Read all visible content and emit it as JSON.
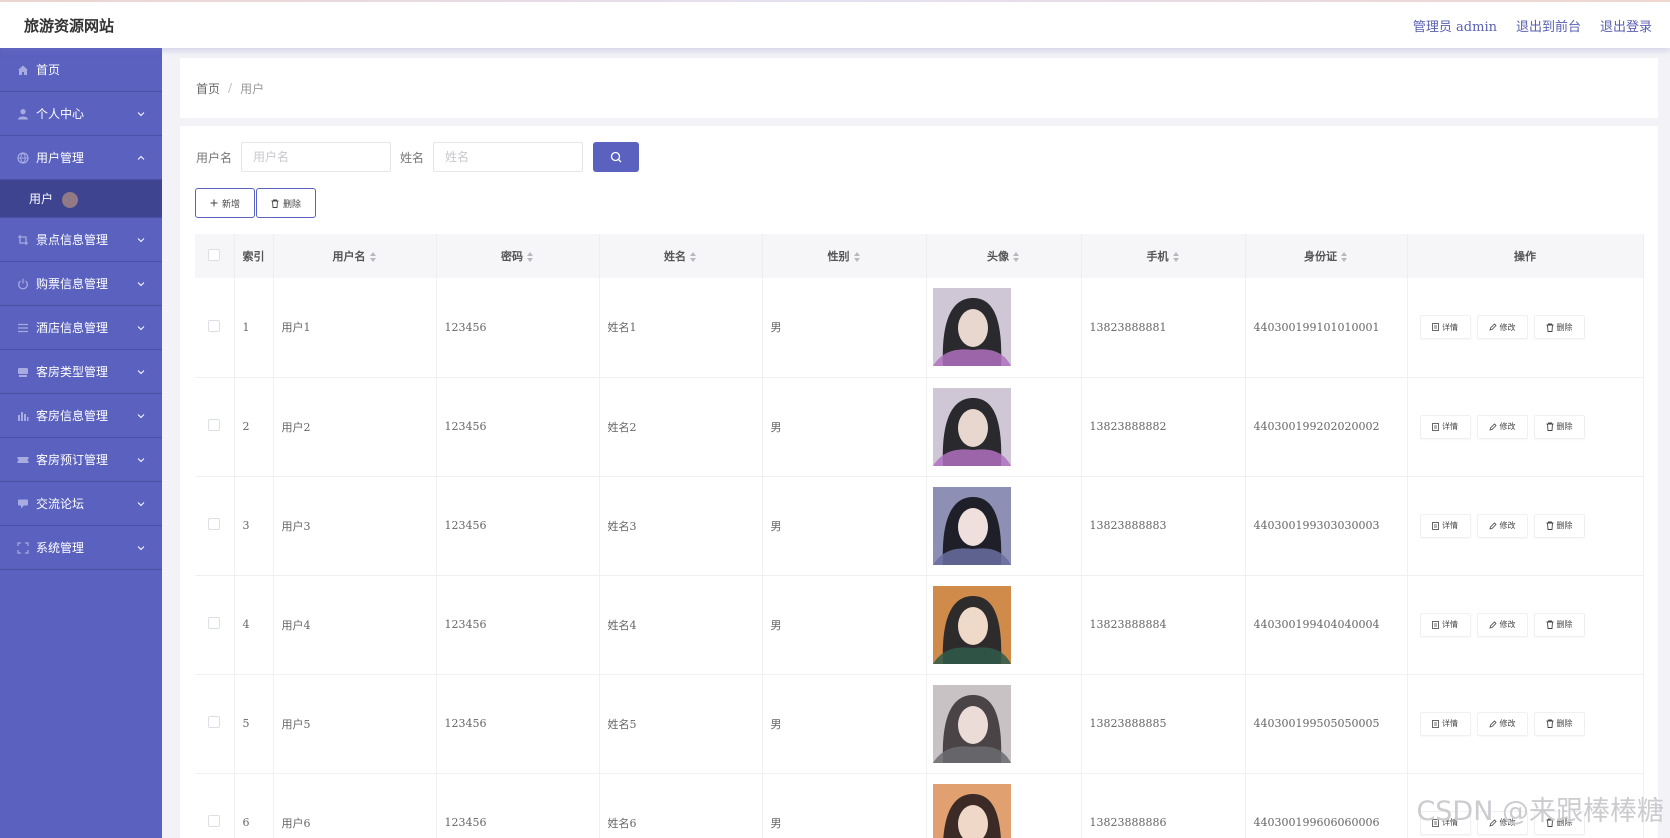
{
  "header": {
    "brand": "旅游资源网站",
    "admin_label": "管理员 admin",
    "front_link": "退出到前台",
    "logout_link": "退出登录"
  },
  "sidebar": {
    "items": [
      {
        "label": "首页",
        "icon": "home-icon",
        "has_children": false
      },
      {
        "label": "个人中心",
        "icon": "user-icon",
        "has_children": true
      },
      {
        "label": "用户管理",
        "icon": "globe-icon",
        "has_children": true,
        "expanded": true
      },
      {
        "label": "景点信息管理",
        "icon": "crop-icon",
        "has_children": true
      },
      {
        "label": "购票信息管理",
        "icon": "power-icon",
        "has_children": true
      },
      {
        "label": "酒店信息管理",
        "icon": "list-icon",
        "has_children": true
      },
      {
        "label": "客房类型管理",
        "icon": "bed-icon",
        "has_children": true
      },
      {
        "label": "客房信息管理",
        "icon": "chart-icon",
        "has_children": true
      },
      {
        "label": "客房预订管理",
        "icon": "ticket-icon",
        "has_children": true
      },
      {
        "label": "交流论坛",
        "icon": "chat-icon",
        "has_children": true
      },
      {
        "label": "系统管理",
        "icon": "fullscreen-icon",
        "has_children": true
      }
    ],
    "submenu": {
      "label": "用户"
    }
  },
  "breadcrumb": {
    "home": "首页",
    "separator": "/",
    "current": "用户"
  },
  "search": {
    "username_label": "用户名",
    "username_placeholder": "用户名",
    "name_label": "姓名",
    "name_placeholder": "姓名"
  },
  "actions": {
    "add_label": "新增",
    "delete_label": "删除"
  },
  "table": {
    "headers": {
      "index": "索引",
      "username": "用户名",
      "password": "密码",
      "name": "姓名",
      "gender": "性别",
      "avatar": "头像",
      "phone": "手机",
      "idcard": "身份证",
      "ops": "操作"
    },
    "op_labels": {
      "detail": "详情",
      "edit": "修改",
      "delete": "删除"
    },
    "rows": [
      {
        "index": "1",
        "username": "用户1",
        "password": "123456",
        "name": "姓名1",
        "gender": "男",
        "phone": "13823888881",
        "idcard": "440300199101010001"
      },
      {
        "index": "2",
        "username": "用户2",
        "password": "123456",
        "name": "姓名2",
        "gender": "男",
        "phone": "13823888882",
        "idcard": "440300199202020002"
      },
      {
        "index": "3",
        "username": "用户3",
        "password": "123456",
        "name": "姓名3",
        "gender": "男",
        "phone": "13823888883",
        "idcard": "440300199303030003"
      },
      {
        "index": "4",
        "username": "用户4",
        "password": "123456",
        "name": "姓名4",
        "gender": "男",
        "phone": "13823888884",
        "idcard": "440300199404040004"
      },
      {
        "index": "5",
        "username": "用户5",
        "password": "123456",
        "name": "姓名5",
        "gender": "男",
        "phone": "13823888885",
        "idcard": "440300199505050005"
      },
      {
        "index": "6",
        "username": "用户6",
        "password": "123456",
        "name": "姓名6",
        "gender": "男",
        "phone": "13823888886",
        "idcard": "440300199606060006"
      }
    ]
  },
  "watermark": "CSDN @来跟棒棒糖",
  "colors": {
    "primary": "#5a61bf",
    "sidebar_active": "#3f4491"
  }
}
